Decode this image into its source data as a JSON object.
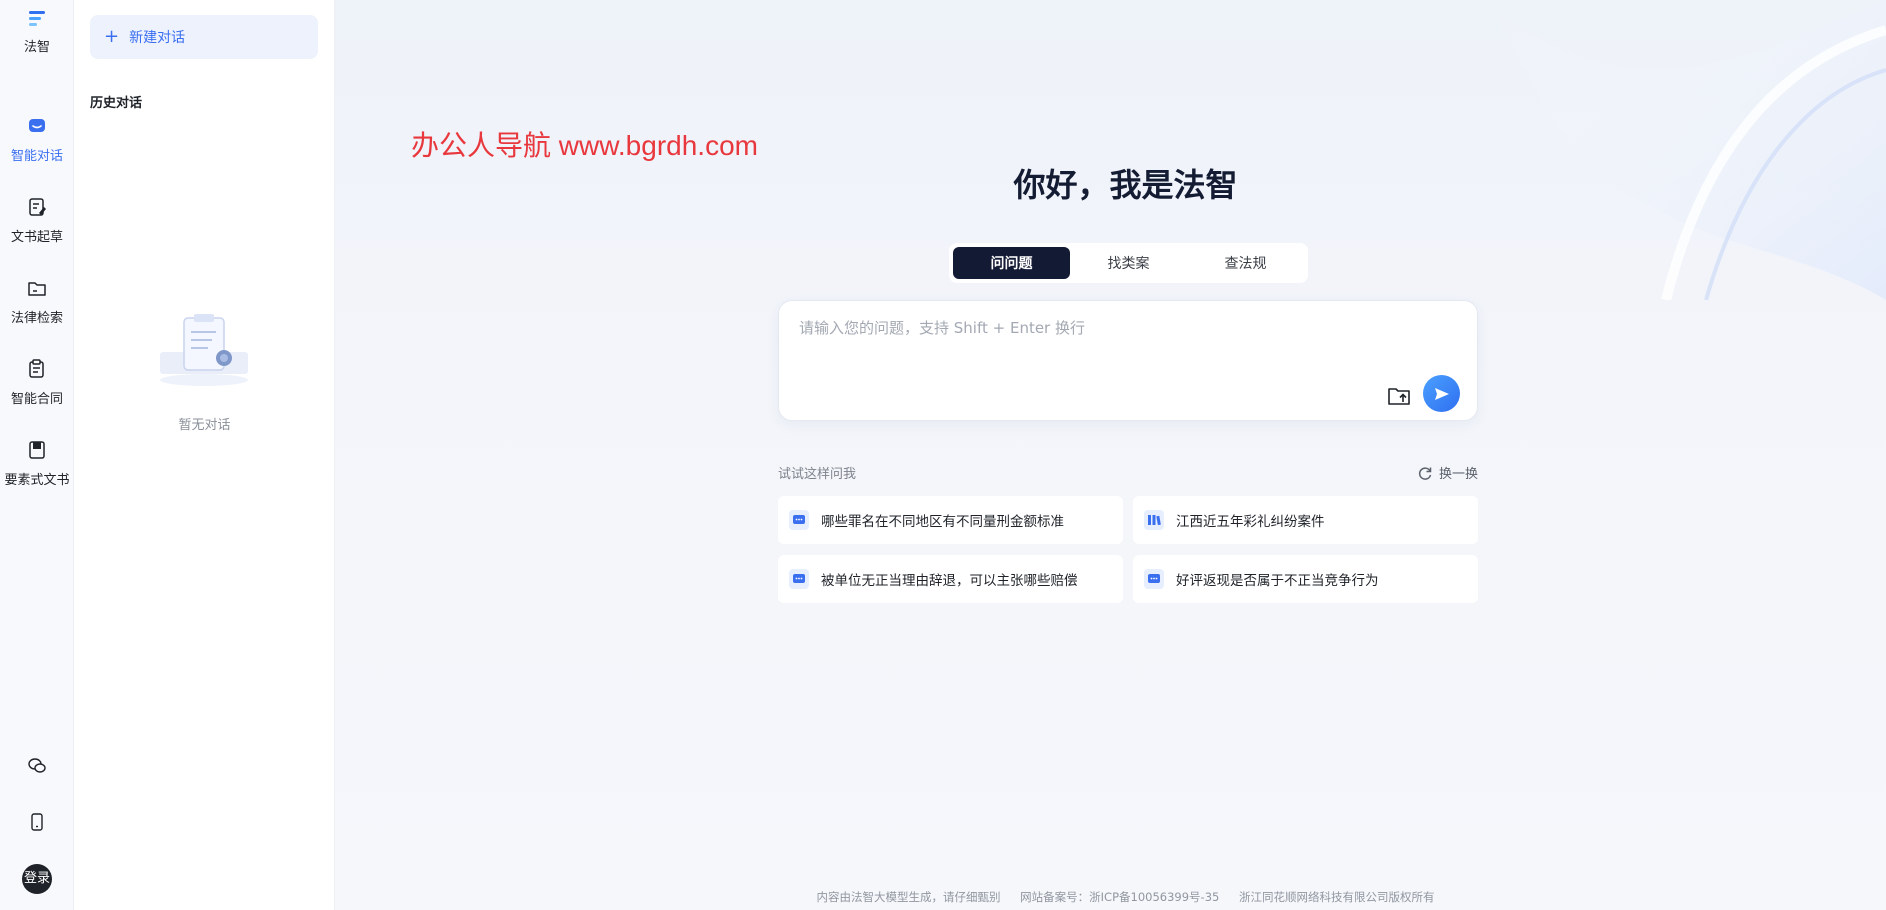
{
  "app": {
    "name": "法智"
  },
  "rail": {
    "items": [
      {
        "label": "智能对话",
        "icon": "chat-bubble-icon",
        "active": true
      },
      {
        "label": "文书起草",
        "icon": "document-edit-icon",
        "active": false
      },
      {
        "label": "法律检索",
        "icon": "folder-search-icon",
        "active": false
      },
      {
        "label": "智能合同",
        "icon": "contract-icon",
        "active": false
      },
      {
        "label": "要素式文书",
        "icon": "book-icon",
        "active": false
      }
    ],
    "bottom": {
      "wechat_icon": "wechat-icon",
      "mobile_icon": "mobile-icon",
      "login_label": "登录"
    }
  },
  "panel": {
    "new_chat_label": "新建对话",
    "history_title": "历史对话",
    "empty_text": "暂无对话"
  },
  "main": {
    "watermark": "办公人导航  www.bgrdh.com",
    "greeting": "你好，我是法智",
    "tabs": [
      {
        "label": "问问题",
        "active": true
      },
      {
        "label": "找类案",
        "active": false
      },
      {
        "label": "查法规",
        "active": false
      }
    ],
    "input": {
      "placeholder": "请输入您的问题，支持 Shift + Enter 换行",
      "value": ""
    },
    "suggest_title": "试试这样问我",
    "refresh_label": "换一换",
    "suggestions": [
      {
        "text": "哪些罪名在不同地区有不同量刑金额标准",
        "icon": "chat-bubble-icon"
      },
      {
        "text": "江西近五年彩礼纠纷案件",
        "icon": "library-icon"
      },
      {
        "text": "被单位无正当理由辞退，可以主张哪些赔偿",
        "icon": "chat-bubble-icon"
      },
      {
        "text": "好评返现是否属于不正当竞争行为",
        "icon": "chat-bubble-icon"
      }
    ]
  },
  "footer": {
    "disclaimer": "内容由法智大模型生成，请仔细甄别",
    "icp": "网站备案号：浙ICP备10056399号-35",
    "copyright": "浙江同花顺网络科技有限公司版权所有"
  },
  "colors": {
    "accent": "#3a6ff0",
    "dark": "#131a33",
    "watermark": "#e8383d"
  }
}
